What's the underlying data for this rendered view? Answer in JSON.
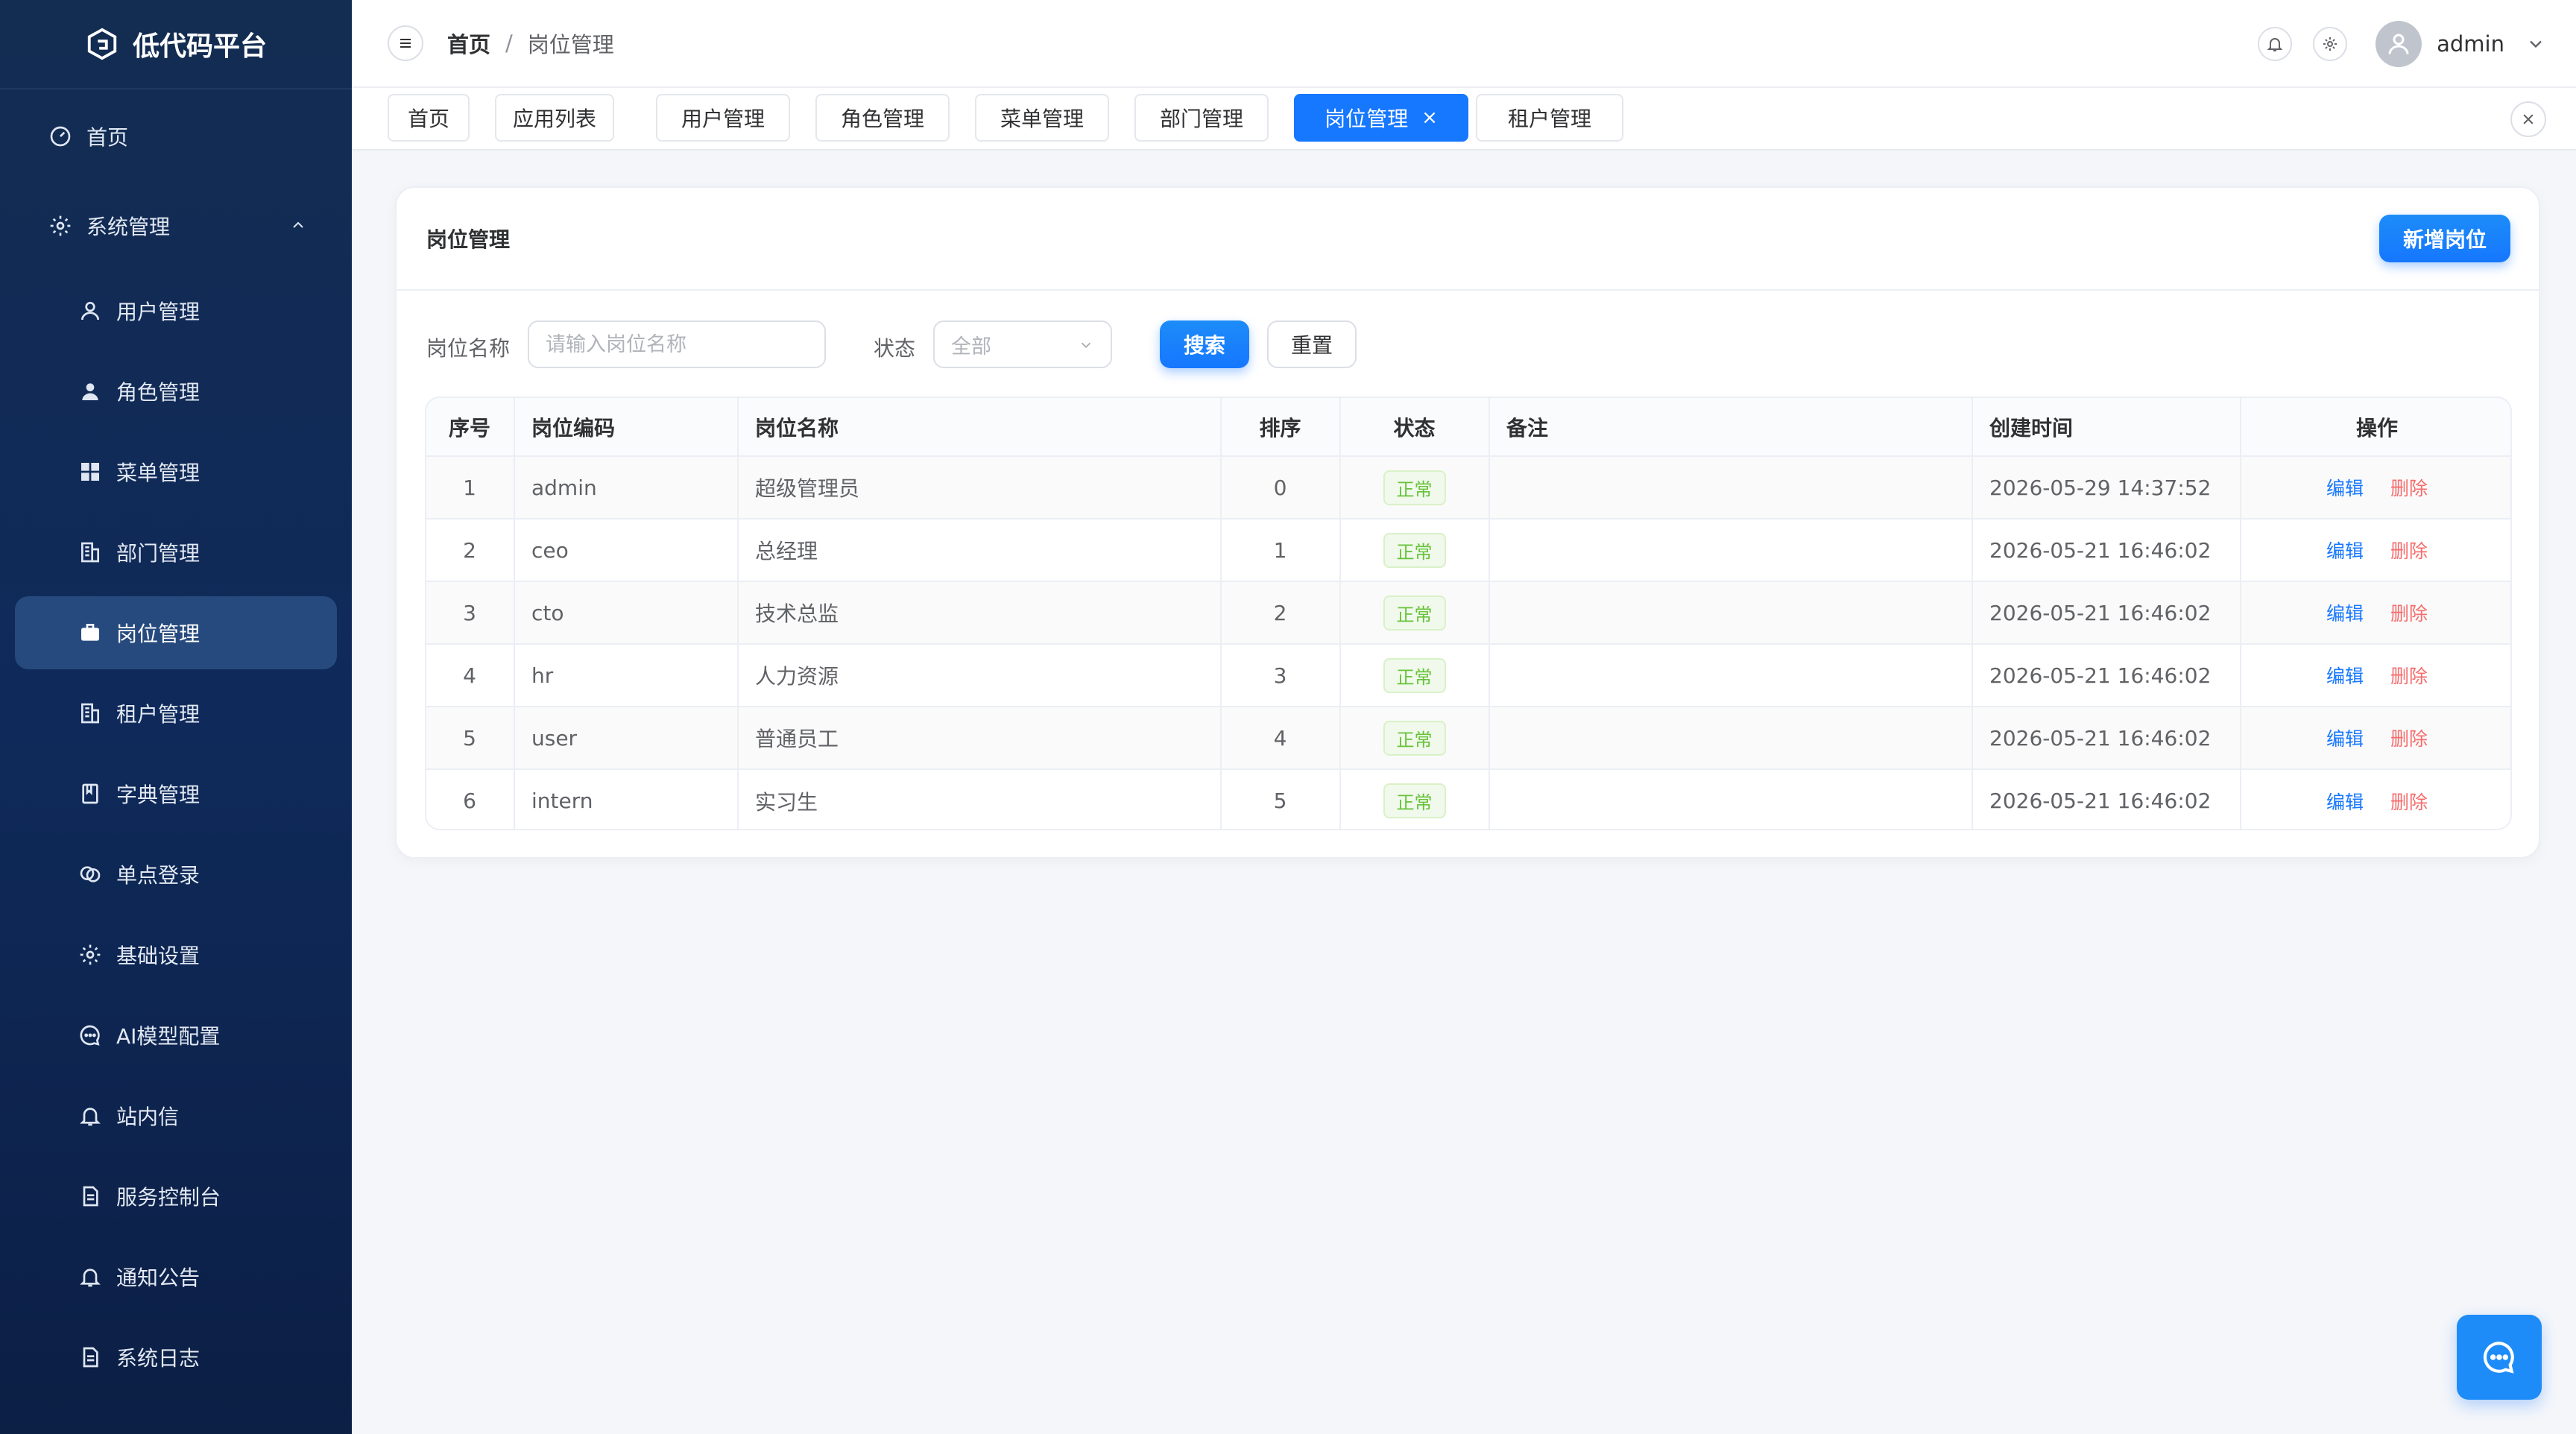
{
  "app": {
    "title": "低代码平台"
  },
  "sidebar": {
    "items": [
      {
        "label": "首页",
        "icon": "dashboard-icon"
      },
      {
        "label": "系统管理",
        "icon": "gear-icon"
      },
      {
        "label": "用户管理",
        "icon": "user-icon"
      },
      {
        "label": "角色管理",
        "icon": "user-filled-icon"
      },
      {
        "label": "菜单管理",
        "icon": "grid-icon"
      },
      {
        "label": "部门管理",
        "icon": "building-icon"
      },
      {
        "label": "岗位管理",
        "icon": "briefcase-icon"
      },
      {
        "label": "租户管理",
        "icon": "building-icon"
      },
      {
        "label": "字典管理",
        "icon": "notebook-icon"
      },
      {
        "label": "单点登录",
        "icon": "link-icon"
      },
      {
        "label": "基础设置",
        "icon": "gear-icon"
      },
      {
        "label": "AI模型配置",
        "icon": "chat-icon"
      },
      {
        "label": "站内信",
        "icon": "bell-icon"
      },
      {
        "label": "服务控制台",
        "icon": "document-icon"
      },
      {
        "label": "通知公告",
        "icon": "bell-icon"
      },
      {
        "label": "系统日志",
        "icon": "document-icon"
      }
    ]
  },
  "header": {
    "breadcrumb": [
      "首页",
      "/",
      "岗位管理"
    ],
    "username": "admin"
  },
  "tabs": [
    "首页",
    "应用列表",
    "用户管理",
    "角色管理",
    "菜单管理",
    "部门管理",
    "岗位管理",
    "租户管理"
  ],
  "tab_close_glyph": "×",
  "card": {
    "title": "岗位管理",
    "add_label": "新增岗位"
  },
  "filters": {
    "name_label": "岗位名称",
    "name_placeholder": "请输入岗位名称",
    "status_label": "状态",
    "status_value": "全部",
    "search_label": "搜索",
    "reset_label": "重置"
  },
  "table": {
    "columns": [
      "序号",
      "岗位编码",
      "岗位名称",
      "排序",
      "状态",
      "备注",
      "创建时间",
      "操作"
    ],
    "rows": [
      {
        "no": "1",
        "code": "admin",
        "name": "超级管理员",
        "sort": "0",
        "status": "正常",
        "remark": "",
        "created": "2026-05-29 14:37:52"
      },
      {
        "no": "2",
        "code": "ceo",
        "name": "总经理",
        "sort": "1",
        "status": "正常",
        "remark": "",
        "created": "2026-05-21 16:46:02"
      },
      {
        "no": "3",
        "code": "cto",
        "name": "技术总监",
        "sort": "2",
        "status": "正常",
        "remark": "",
        "created": "2026-05-21 16:46:02"
      },
      {
        "no": "4",
        "code": "hr",
        "name": "人力资源",
        "sort": "3",
        "status": "正常",
        "remark": "",
        "created": "2026-05-21 16:46:02"
      },
      {
        "no": "5",
        "code": "user",
        "name": "普通员工",
        "sort": "4",
        "status": "正常",
        "remark": "",
        "created": "2026-05-21 16:46:02"
      },
      {
        "no": "6",
        "code": "intern",
        "name": "实习生",
        "sort": "5",
        "status": "正常",
        "remark": "",
        "created": "2026-05-21 16:46:02"
      }
    ],
    "edit_label": "编辑",
    "delete_label": "删除"
  },
  "colors": {
    "accent": "#1677ff",
    "sidebar_bg": "#0f2a5a",
    "sidebar_active": "#264a7d",
    "status_ok": "#67c23a",
    "danger": "#f56c6c"
  }
}
